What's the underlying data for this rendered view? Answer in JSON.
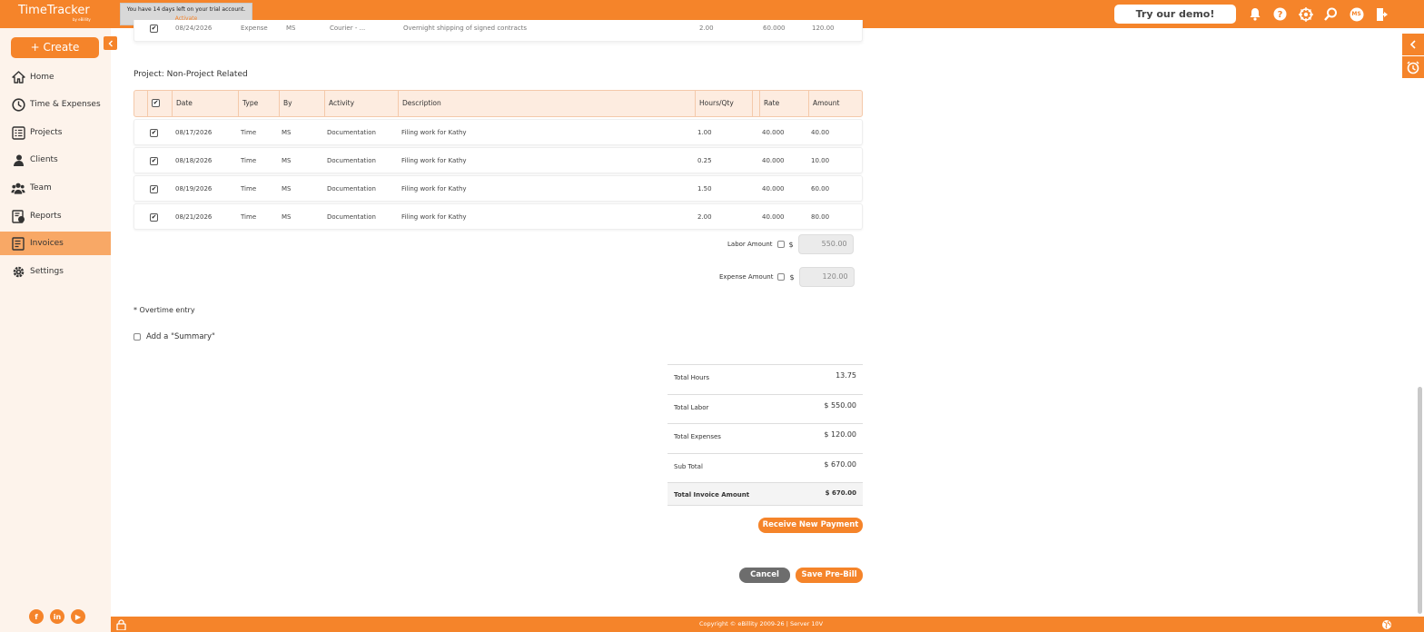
{
  "app": {
    "logo": "TimeTracker",
    "logo_sub": "by eBillity"
  },
  "trial": {
    "message": "You have 14 days left on your trial account.",
    "activate": "Activate"
  },
  "topbar": {
    "demo_label": "Try our demo!",
    "avatar": "MS"
  },
  "sidebar": {
    "create_label": "+ Create",
    "items": [
      {
        "label": "Home",
        "icon": "home-icon"
      },
      {
        "label": "Time & Expenses",
        "icon": "clock-icon"
      },
      {
        "label": "Projects",
        "icon": "projects-icon"
      },
      {
        "label": "Clients",
        "icon": "clients-icon"
      },
      {
        "label": "Team",
        "icon": "team-icon"
      },
      {
        "label": "Reports",
        "icon": "reports-icon"
      },
      {
        "label": "Invoices",
        "icon": "invoices-icon",
        "active": true
      },
      {
        "label": "Settings",
        "icon": "gear-icon"
      }
    ],
    "social": [
      "f",
      "in",
      "▶"
    ]
  },
  "prev_row": {
    "date": "08/24/2026",
    "type": "Expense",
    "by": "MS",
    "activity": "Courier - ...",
    "description": "Overnight shipping of signed contracts",
    "hours": "2.00",
    "rate": "60.000",
    "amount": "120.00"
  },
  "project": {
    "title": "Project: Non-Project Related"
  },
  "table": {
    "headers": {
      "date": "Date",
      "type": "Type",
      "by": "By",
      "activity": "Activity",
      "description": "Description",
      "hours": "Hours/Qty",
      "rate": "Rate",
      "amount": "Amount"
    },
    "rows": [
      {
        "date": "08/17/2026",
        "type": "Time",
        "by": "MS",
        "activity": "Documentation",
        "description": "Filing work for Kathy",
        "hours": "1.00",
        "rate": "40.000",
        "amount": "40.00"
      },
      {
        "date": "08/18/2026",
        "type": "Time",
        "by": "MS",
        "activity": "Documentation",
        "description": "Filing work for Kathy",
        "hours": "0.25",
        "rate": "40.000",
        "amount": "10.00"
      },
      {
        "date": "08/19/2026",
        "type": "Time",
        "by": "MS",
        "activity": "Documentation",
        "description": "Filing work for Kathy",
        "hours": "1.50",
        "rate": "40.000",
        "amount": "60.00"
      },
      {
        "date": "08/21/2026",
        "type": "Time",
        "by": "MS",
        "activity": "Documentation",
        "description": "Filing work for Kathy",
        "hours": "2.00",
        "rate": "40.000",
        "amount": "80.00"
      }
    ]
  },
  "amounts": {
    "labor_label": "Labor Amount",
    "labor_value": "550.00",
    "expense_label": "Expense Amount",
    "expense_value": "120.00",
    "currency": "$"
  },
  "overtime_note": "* Overtime entry",
  "summary_label": "Add a \"Summary\"",
  "totals": {
    "hours_label": "Total Hours",
    "hours_value": "13.75",
    "labor_label": "Total Labor",
    "labor_value": "$ 550.00",
    "expenses_label": "Total Expenses",
    "expenses_value": "$ 120.00",
    "subtotal_label": "Sub Total",
    "subtotal_value": "$ 670.00",
    "invoice_label": "Total Invoice Amount",
    "invoice_value": "$ 670.00"
  },
  "buttons": {
    "receive_payment": "Receive New Payment",
    "cancel": "Cancel",
    "save": "Save Pre-Bill"
  },
  "footer": {
    "copyright": "Copyright © eBillity 2009-26 | Server 10V"
  },
  "colors": {
    "accent": "#f5842a",
    "active_nav": "#f8a866",
    "sidebar_bg": "#fdf3eb"
  }
}
